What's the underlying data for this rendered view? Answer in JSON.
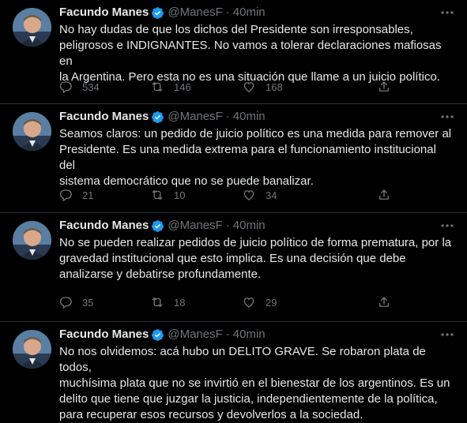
{
  "author": {
    "name": "Facundo Manes",
    "handle": "@ManesF",
    "dot": "·",
    "verified": true
  },
  "icons": {
    "reply": "reply-icon",
    "retweet": "retweet-icon",
    "like": "heart-icon",
    "share": "share-icon",
    "more": "more-icon",
    "verified": "verified-badge-icon"
  },
  "colors": {
    "background": "#000000",
    "text": "#e7e9ea",
    "muted": "#71767b",
    "verified": "#1d9bf0",
    "divider": "#2f3336"
  },
  "tweets": [
    {
      "time": "40min",
      "text": "No hay dudas de que los dichos del Presidente son irresponsables,\npeligrosos e INDIGNANTES. No vamos a tolerar declaraciones mafiosas en\nla Argentina. Pero esta no es una situación que llame a un juicio político.",
      "replies": "534",
      "retweets": "146",
      "likes": "168"
    },
    {
      "time": "40min",
      "text": "Seamos claros: un pedido de juicio político es una medida para remover al\nPresidente. Es una medida extrema para el funcionamiento institucional del\nsistema democrático que no se puede banalizar.",
      "replies": "21",
      "retweets": "10",
      "likes": "34"
    },
    {
      "time": "40min",
      "text": "No se pueden realizar pedidos de juicio político de forma prematura, por la\ngravedad institucional que esto implica. Es una decisión que debe\nanalizarse y debatirse profundamente.",
      "replies": "35",
      "retweets": "18",
      "likes": "29"
    },
    {
      "time": "40min",
      "text": "No nos olvidemos: acá hubo un DELITO GRAVE. Se robaron plata de todos,\nmuchísima plata que no se invirtió en el bienestar de los argentinos. Es un\ndelito que tiene que juzgar la justicia, independientemente de la política,\npara recuperar esos recursos y devolverlos a la sociedad."
    }
  ]
}
